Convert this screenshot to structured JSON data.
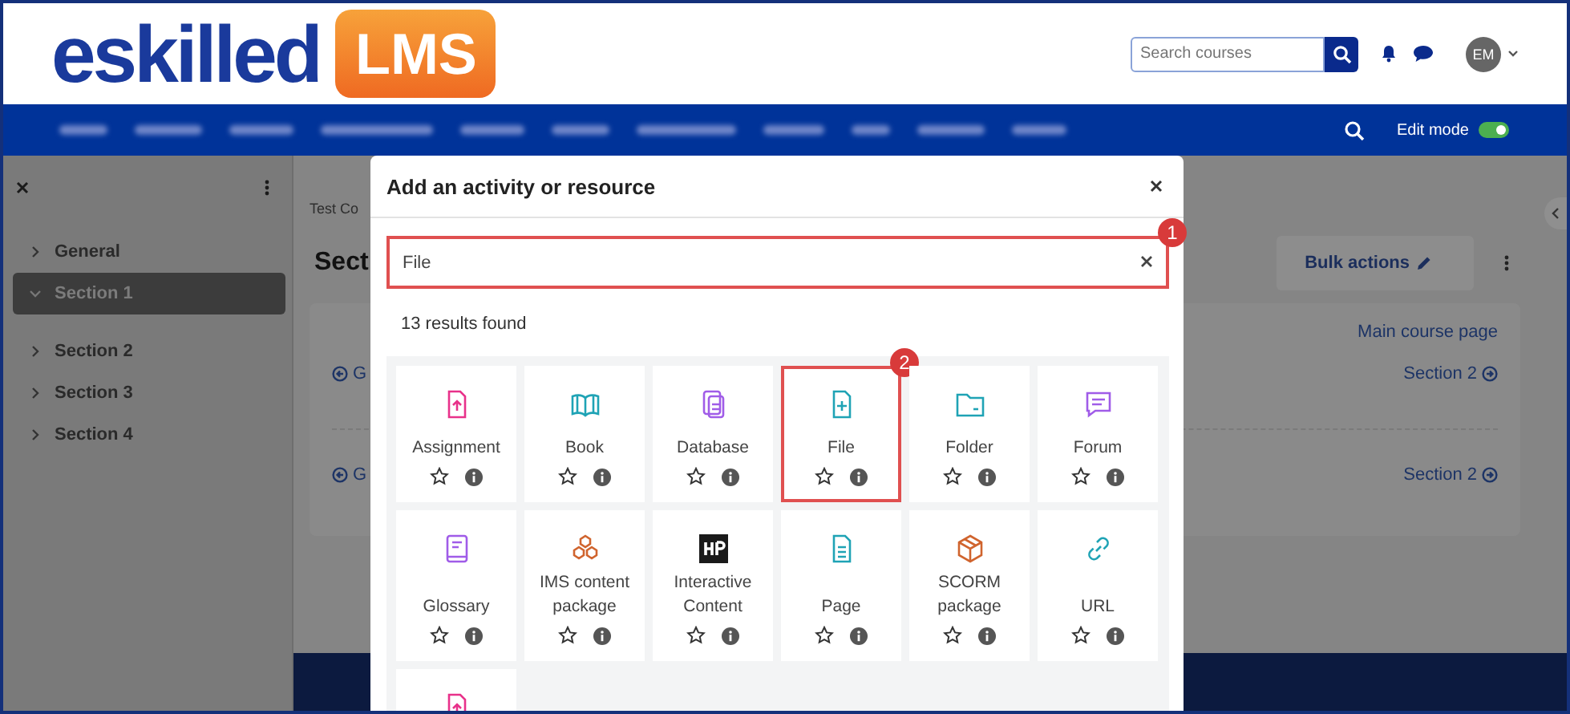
{
  "header": {
    "logo_text": "eskilled",
    "logo_badge": "LMS",
    "search": {
      "placeholder": "Search courses"
    },
    "avatar": "EM"
  },
  "navbar": {
    "edit_mode": {
      "label": "Edit mode",
      "on": true
    }
  },
  "sidebar": {
    "items": [
      {
        "label": "General",
        "expanded": false,
        "selected": false
      },
      {
        "label": "Section 1",
        "expanded": true,
        "selected": true
      },
      {
        "label": "Section 2",
        "expanded": false,
        "selected": false
      },
      {
        "label": "Section 3",
        "expanded": false,
        "selected": false
      },
      {
        "label": "Section 4",
        "expanded": false,
        "selected": false
      }
    ]
  },
  "page": {
    "breadcrumb": "Test Co",
    "heading": "Sect",
    "bulk_actions": "Bulk actions",
    "main_course_link": "Main course page",
    "nav_rows": [
      {
        "prev": "G",
        "next": "Section 2"
      },
      {
        "prev": "G",
        "next": "Section 2"
      }
    ]
  },
  "modal": {
    "title": "Add an activity or resource",
    "search": {
      "value": "File",
      "highlighted": true,
      "badge": "1"
    },
    "results": "13 results found",
    "cards": [
      {
        "label": "Assignment",
        "kind": "assignment",
        "color": "#e8318a",
        "highlighted": false
      },
      {
        "label": "Book",
        "kind": "book",
        "color": "#1fa3b5",
        "highlighted": false
      },
      {
        "label": "Database",
        "kind": "database",
        "color": "#a05ce8",
        "highlighted": false
      },
      {
        "label": "File",
        "kind": "file",
        "color": "#1fa3b5",
        "highlighted": true,
        "badge": "2"
      },
      {
        "label": "Folder",
        "kind": "folder",
        "color": "#1fa3b5",
        "highlighted": false
      },
      {
        "label": "Forum",
        "kind": "forum",
        "color": "#a05ce8",
        "highlighted": false
      },
      {
        "label": "Glossary",
        "kind": "glossary",
        "color": "#a05ce8",
        "highlighted": false
      },
      {
        "label": "IMS content package",
        "kind": "ims",
        "color": "#d0642e",
        "highlighted": false
      },
      {
        "label": "Interactive Content",
        "kind": "h5p",
        "color": "#1a1a1a",
        "highlighted": false
      },
      {
        "label": "Page",
        "kind": "page",
        "color": "#1fa3b5",
        "highlighted": false
      },
      {
        "label": "SCORM package",
        "kind": "scorm",
        "color": "#d0642e",
        "highlighted": false
      },
      {
        "label": "URL",
        "kind": "url",
        "color": "#1fa3b5",
        "highlighted": false
      },
      {
        "kind": "partial",
        "color": "#e8318a",
        "highlighted": false
      }
    ]
  }
}
